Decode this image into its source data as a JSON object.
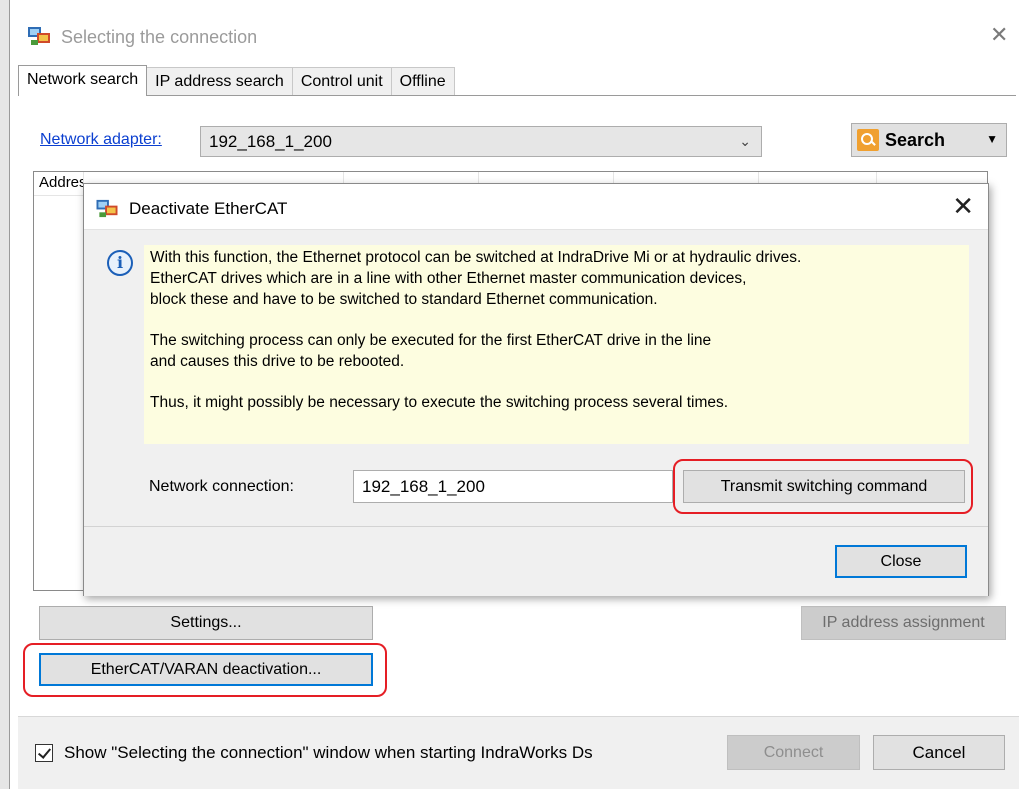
{
  "window": {
    "title": "Selecting the connection",
    "close_glyph": "✕"
  },
  "tabs": [
    {
      "label": "Network search",
      "active": true
    },
    {
      "label": "IP address search",
      "active": false
    },
    {
      "label": "Control unit",
      "active": false
    },
    {
      "label": "Offline",
      "active": false
    }
  ],
  "network_search": {
    "adapter_label": "Network adapter:",
    "adapter_value": "192_168_1_200",
    "search_label": "Search",
    "list_columns": [
      "Address"
    ]
  },
  "buttons": {
    "settings": "Settings...",
    "ip_assign": "IP address assignment",
    "ethercat_deactivation": "EtherCAT/VARAN deactivation...",
    "connect": "Connect",
    "cancel": "Cancel"
  },
  "show_on_start": {
    "checked": true,
    "label": "Show \"Selecting the connection\" window when starting IndraWorks Ds"
  },
  "dialog": {
    "title": "Deactivate EtherCAT",
    "close_glyph": "✕",
    "info_paragraphs": [
      "With this function, the Ethernet protocol can be switched at IndraDrive Mi or at hydraulic drives.\nEtherCAT drives which are in a line with other Ethernet master communication devices,\nblock these and have to be switched to standard Ethernet communication.",
      "The switching process can only be executed for the first EtherCAT drive in the line\nand causes this drive to be rebooted.",
      "Thus, it might possibly be necessary to execute the switching process several times."
    ],
    "network_connection_label": "Network connection:",
    "network_connection_value": "192_168_1_200",
    "transmit_label": "Transmit switching command",
    "close_label": "Close"
  },
  "colors": {
    "highlight": "#e51e25",
    "focus_border": "#0078d7",
    "info_background": "#fdfde0",
    "link": "#0b3fd0"
  }
}
